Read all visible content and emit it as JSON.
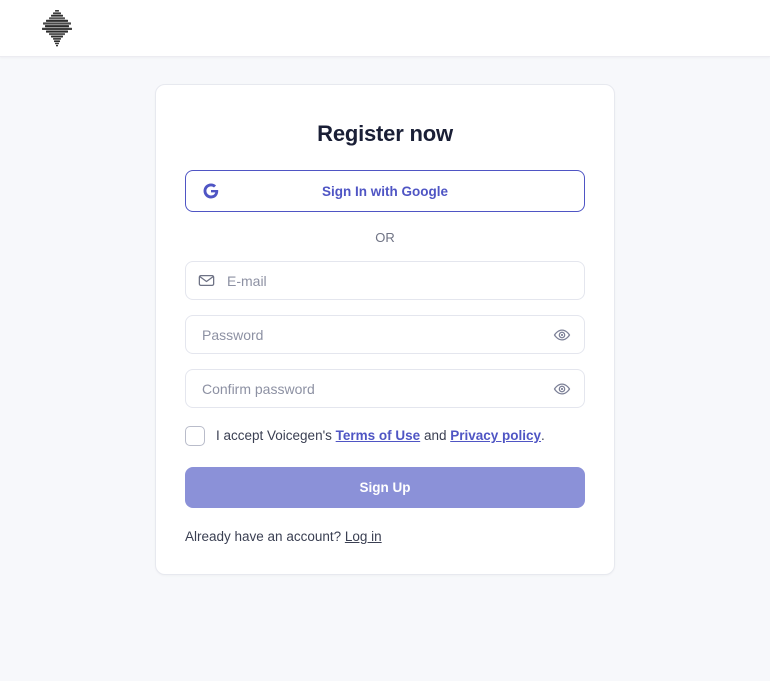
{
  "header": {
    "logo_name": "voicegen-waveform-logo"
  },
  "card": {
    "title": "Register now",
    "google_button": {
      "label": "Sign In with Google",
      "icon": "google-g-icon",
      "color": "#4f55c4"
    },
    "divider_label": "OR",
    "fields": [
      {
        "name": "email",
        "placeholder": "E-mail",
        "value": "",
        "type": "text",
        "lead_icon": "envelope-icon",
        "trail_icon": ""
      },
      {
        "name": "password",
        "placeholder": "Password",
        "value": "",
        "type": "password",
        "lead_icon": "",
        "trail_icon": "eye-icon"
      },
      {
        "name": "confirm-password",
        "placeholder": "Confirm password",
        "value": "",
        "type": "password",
        "lead_icon": "",
        "trail_icon": "eye-icon"
      }
    ],
    "terms": {
      "checked": false,
      "prefix": "I accept Voicegen's ",
      "terms_link": "Terms of Use",
      "conjunction": " and ",
      "privacy_link": "Privacy policy",
      "suffix": "."
    },
    "submit_label": "Sign Up",
    "submit_color": "#8b91d8",
    "footer": {
      "text": "Already have an account? ",
      "link_label": "Log in"
    }
  }
}
